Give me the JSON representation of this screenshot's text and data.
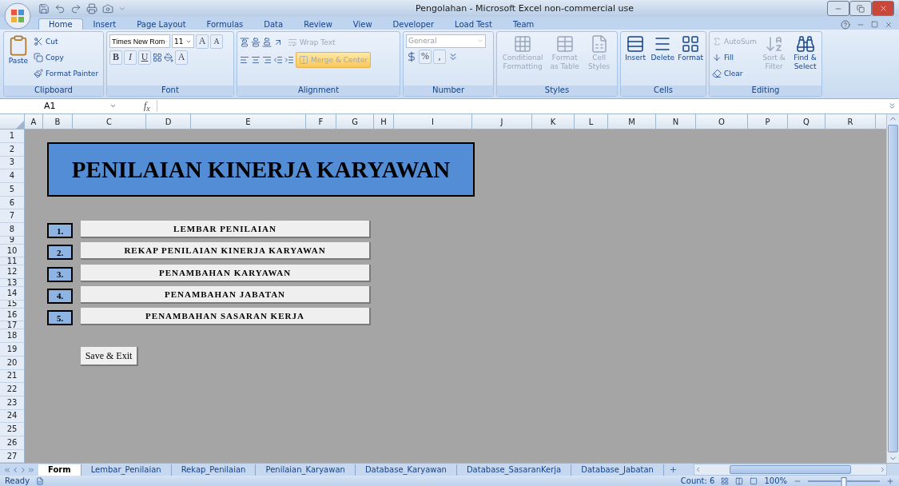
{
  "window": {
    "title": "Pengolahan - Microsoft Excel non-commercial use"
  },
  "ribbon_tabs": [
    {
      "label": "Home",
      "selected": true
    },
    {
      "label": "Insert",
      "selected": false
    },
    {
      "label": "Page Layout",
      "selected": false
    },
    {
      "label": "Formulas",
      "selected": false
    },
    {
      "label": "Data",
      "selected": false
    },
    {
      "label": "Review",
      "selected": false
    },
    {
      "label": "View",
      "selected": false
    },
    {
      "label": "Developer",
      "selected": false
    },
    {
      "label": "Load Test",
      "selected": false
    },
    {
      "label": "Team",
      "selected": false
    }
  ],
  "clipboard": {
    "label": "Clipboard",
    "paste": "Paste",
    "items": [
      {
        "label": "Cut"
      },
      {
        "label": "Copy"
      },
      {
        "label": "Format Painter"
      }
    ]
  },
  "font": {
    "label": "Font",
    "font_name": "Times New Rom",
    "font_size": "11",
    "grow": "A",
    "shrink": "A",
    "bold": "B",
    "italic": "I",
    "underline": "U",
    "font_color": "A"
  },
  "alignment": {
    "label": "Alignment",
    "wrap_text": {
      "label": "Wrap Text",
      "disabled": true
    },
    "merge": {
      "label": "Merge & Center",
      "highlighted": true
    }
  },
  "number": {
    "label": "Number",
    "format": "General",
    "percent": "%",
    "comma": ","
  },
  "styles": {
    "label": "Styles",
    "items": [
      {
        "label": "Conditional Formatting",
        "disabled": true
      },
      {
        "label": "Format as Table",
        "disabled": true
      },
      {
        "label": "Cell Styles",
        "disabled": true
      }
    ]
  },
  "cells": {
    "label": "Cells",
    "items": [
      {
        "label": "Insert"
      },
      {
        "label": "Delete"
      },
      {
        "label": "Format"
      }
    ]
  },
  "editing": {
    "label": "Editing",
    "autosum": {
      "label": "AutoSum",
      "disabled": true
    },
    "fill": "Fill",
    "clear": "Clear",
    "sort": {
      "label": "Sort & Filter",
      "disabled": true
    },
    "find": {
      "label": "Find & Select",
      "disabled": false
    }
  },
  "formula_bar": {
    "name_box": "A1",
    "fx": "f$_{x}$"
  },
  "columns": [
    "A",
    "B",
    "C",
    "D",
    "E",
    "F",
    "G",
    "H",
    "I",
    "J",
    "K",
    "L",
    "M",
    "N",
    "O",
    "P",
    "Q",
    "R"
  ],
  "rows": [
    "1",
    "2",
    "3",
    "4",
    "5",
    "6",
    "7",
    "8",
    "9",
    "10",
    "11",
    "12",
    "13",
    "14",
    "15",
    "16",
    "17",
    "18",
    "19",
    "20",
    "21",
    "22",
    "23",
    "24",
    "25",
    "26",
    "27"
  ],
  "sheet": {
    "title": "PENILAIAN KINERJA KARYAWAN",
    "menu": [
      {
        "number": "1.",
        "label": "LEMBAR PENILAIAN"
      },
      {
        "number": "2.",
        "label": "REKAP PENILAIAN KINERJA KARYAWAN"
      },
      {
        "number": "3.",
        "label": "PENAMBAHAN KARYAWAN"
      },
      {
        "number": "4.",
        "label": "PENAMBAHAN JABATAN"
      },
      {
        "number": "5.",
        "label": "PENAMBAHAN SASARAN KERJA"
      }
    ],
    "save_button": "Save & Exit"
  },
  "sheet_tabs": [
    {
      "label": "Form",
      "selected": true
    },
    {
      "label": "Lembar_Penilaian",
      "selected": false
    },
    {
      "label": "Rekap_Penilaian",
      "selected": false
    },
    {
      "label": "Penilaian_Karyawan",
      "selected": false
    },
    {
      "label": "Database_Karyawan",
      "selected": false
    },
    {
      "label": "Database_SasaranKerja",
      "selected": false
    },
    {
      "label": "Database_Jabatan",
      "selected": false
    }
  ],
  "status_bar": {
    "mode": "Ready",
    "count": "Count: 6",
    "zoom": {
      "label": "100%",
      "level": 0.5
    }
  }
}
